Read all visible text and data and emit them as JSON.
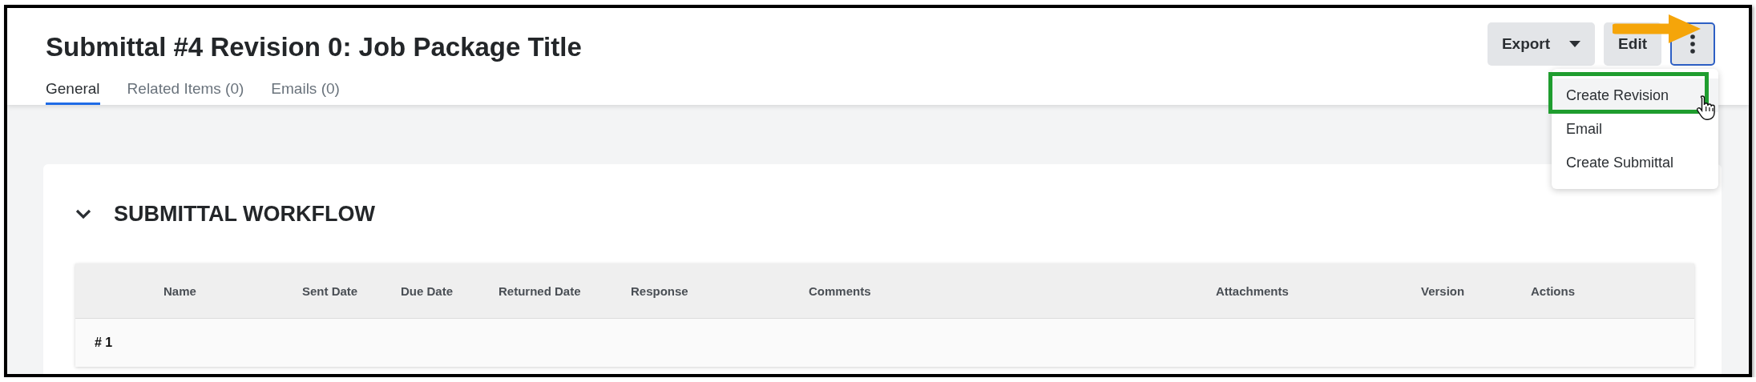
{
  "header": {
    "title": "Submittal #4 Revision 0: Job Package Title",
    "tabs": [
      {
        "label": "General",
        "selected": true
      },
      {
        "label": "Related Items (0)",
        "selected": false
      },
      {
        "label": "Emails (0)",
        "selected": false
      }
    ],
    "buttons": [
      {
        "kind": "dropdown",
        "label": "Export"
      },
      {
        "kind": "plain",
        "label": "Edit"
      },
      {
        "kind": "more",
        "focused": true
      }
    ]
  },
  "more_menu": {
    "open": true,
    "items": [
      {
        "label": "Create Revision",
        "highlighted": true
      },
      {
        "label": "Email",
        "highlighted": false
      },
      {
        "label": "Create Submittal",
        "highlighted": false
      }
    ]
  },
  "section": {
    "title": "SUBMITTAL WORKFLOW",
    "expanded": true,
    "table": {
      "columns": [
        "Name",
        "Sent Date",
        "Due Date",
        "Returned Date",
        "Response",
        "Comments",
        "Attachments",
        "Version",
        "Actions"
      ],
      "rows": [
        {
          "label": "# 1"
        }
      ]
    }
  }
}
